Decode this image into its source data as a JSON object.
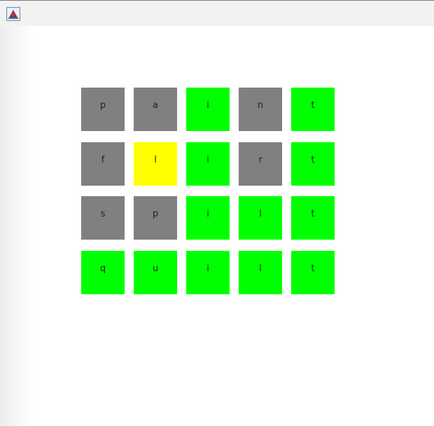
{
  "window": {
    "icon": "java-app-icon"
  },
  "colors": {
    "correct": "#00ff00",
    "present": "#ffff00",
    "absent": "#808080"
  },
  "board": {
    "rows": [
      {
        "tiles": [
          {
            "letter": "p",
            "state": "absent"
          },
          {
            "letter": "a",
            "state": "absent"
          },
          {
            "letter": "i",
            "state": "correct"
          },
          {
            "letter": "n",
            "state": "absent"
          },
          {
            "letter": "t",
            "state": "correct"
          }
        ]
      },
      {
        "tiles": [
          {
            "letter": "f",
            "state": "absent"
          },
          {
            "letter": "l",
            "state": "present"
          },
          {
            "letter": "i",
            "state": "correct"
          },
          {
            "letter": "r",
            "state": "absent"
          },
          {
            "letter": "t",
            "state": "correct"
          }
        ]
      },
      {
        "tiles": [
          {
            "letter": "s",
            "state": "absent"
          },
          {
            "letter": "p",
            "state": "absent"
          },
          {
            "letter": "i",
            "state": "correct"
          },
          {
            "letter": "l",
            "state": "correct"
          },
          {
            "letter": "t",
            "state": "correct"
          }
        ]
      },
      {
        "tiles": [
          {
            "letter": "q",
            "state": "correct"
          },
          {
            "letter": "u",
            "state": "correct"
          },
          {
            "letter": "i",
            "state": "correct"
          },
          {
            "letter": "l",
            "state": "correct"
          },
          {
            "letter": "t",
            "state": "correct"
          }
        ]
      }
    ]
  }
}
